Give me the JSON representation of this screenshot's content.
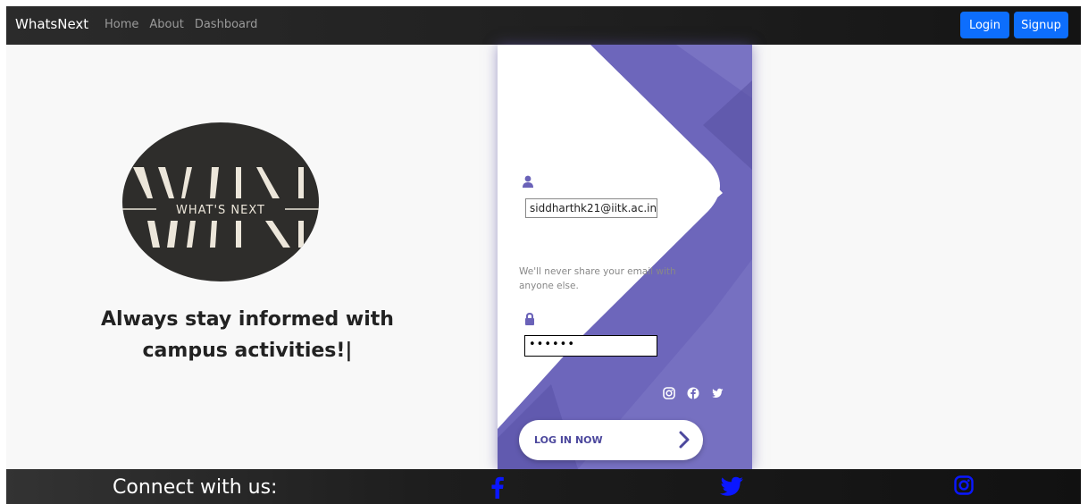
{
  "navbar": {
    "brand": "WhatsNext",
    "links": [
      "Home",
      "About",
      "Dashboard"
    ],
    "login_label": "Login",
    "signup_label": "Signup"
  },
  "hero": {
    "logo_text": "WHAT'S NEXT",
    "tagline_line1": "Always stay informed with",
    "tagline_line2": "campus activities!|"
  },
  "login_form": {
    "email_value": "siddharthk21@iitk.ac.in",
    "email_help": "We'll never share your email with anyone else.",
    "password_value": "••••••",
    "submit_label": "LOG IN NOW"
  },
  "footer": {
    "label": "Connect with us:"
  },
  "colors": {
    "accent": "#0d6efd",
    "card_purple": "#6a62b8",
    "footer_icons": "#0a17ff"
  },
  "icons": [
    "user-icon",
    "lock-icon",
    "instagram-icon",
    "facebook-icon",
    "twitter-icon",
    "chevron-right-icon"
  ]
}
